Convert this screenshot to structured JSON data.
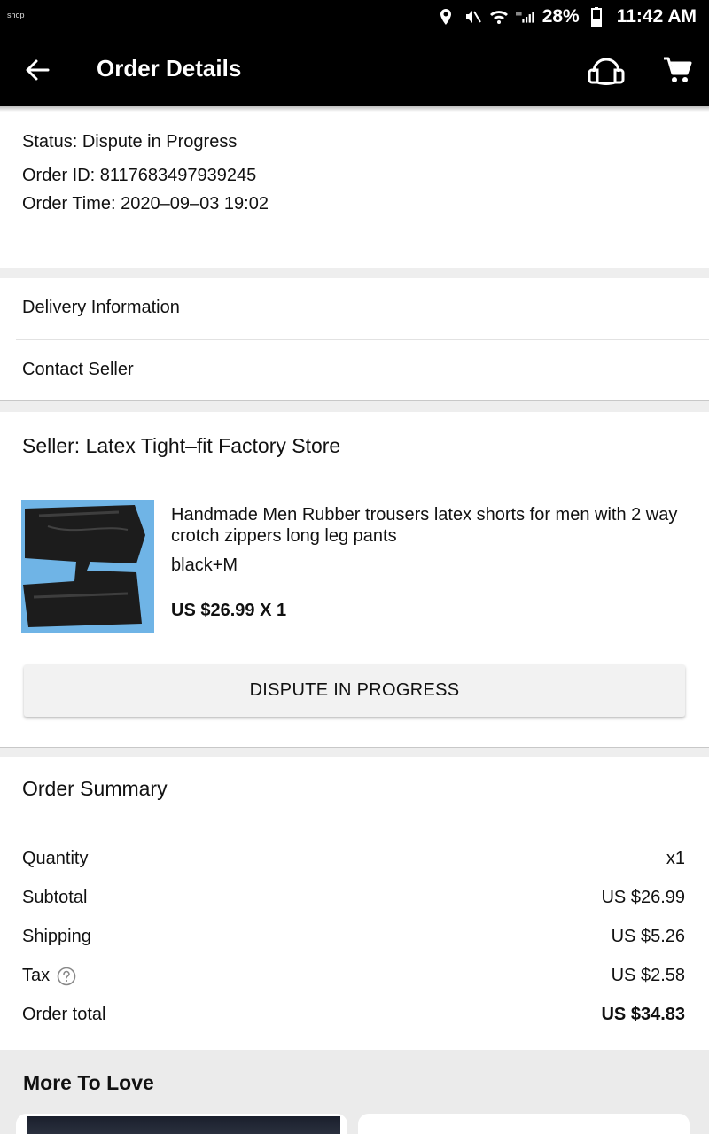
{
  "status_bar": {
    "app_label": "shop",
    "battery": "28%",
    "time": "11:42 AM",
    "icons": [
      "location-icon",
      "mute-icon",
      "wifi-icon",
      "signal-icon",
      "battery-icon"
    ]
  },
  "app_bar": {
    "title": "Order Details",
    "icons": [
      "back-arrow-icon",
      "headset-icon",
      "cart-icon"
    ]
  },
  "order": {
    "status_line": "Status:  Dispute in Progress",
    "id_line": "Order ID:  8117683497939245",
    "time_line": "Order Time:  2020–09–03 19:02"
  },
  "links": {
    "delivery": "Delivery Information",
    "contact": "Contact Seller"
  },
  "seller": {
    "title": "Seller:  Latex Tight–fit Factory Store"
  },
  "product": {
    "title": "Handmade Men Rubber trousers latex shorts for men with 2 way crotch zippers long leg pants",
    "variant": "black+M",
    "price": "US $26.99  X 1",
    "button": "DISPUTE IN PROGRESS"
  },
  "summary": {
    "heading": "Order Summary",
    "rows": [
      {
        "label": "Quantity",
        "value": "x1"
      },
      {
        "label": "Subtotal",
        "value": "US $26.99"
      },
      {
        "label": "Shipping",
        "value": "US $5.26"
      },
      {
        "label": "Tax",
        "value": "US $2.58"
      },
      {
        "label": "Order total",
        "value": "US $34.83"
      }
    ]
  },
  "more": {
    "heading": "More To Love"
  },
  "colors": {
    "bar_bg": "#000000",
    "page_bg": "#ffffff",
    "separator": "#eeeeee",
    "button_bg": "#f2f2f2",
    "product_bg": "#6fb4e6"
  }
}
